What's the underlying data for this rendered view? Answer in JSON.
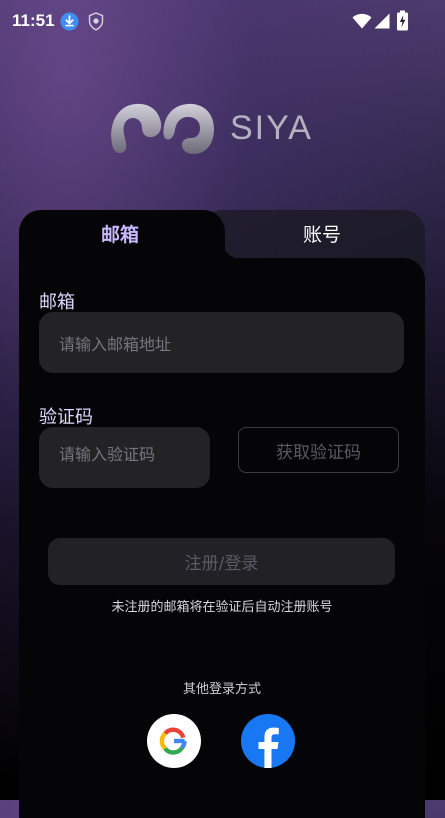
{
  "status_bar": {
    "time": "11:51",
    "icons": [
      "download-icon",
      "shield-icon",
      "wifi-icon",
      "signal-icon",
      "battery-charging-icon"
    ]
  },
  "logo": {
    "text": "SIYA",
    "icon": "siya-logo-icon"
  },
  "tabs": [
    {
      "label": "邮箱",
      "active": true
    },
    {
      "label": "账号",
      "active": false
    }
  ],
  "form": {
    "email_label": "邮箱",
    "email_placeholder": "请输入邮箱地址",
    "code_label": "验证码",
    "code_placeholder": "请输入验证码",
    "get_code_label": "获取验证码",
    "submit_label": "注册/登录",
    "hint": "未注册的邮箱将在验证后自动注册账号"
  },
  "other_login": {
    "label": "其他登录方式",
    "providers": [
      {
        "name": "google",
        "icon": "google-icon"
      },
      {
        "name": "facebook",
        "icon": "facebook-icon"
      }
    ]
  },
  "colors": {
    "accent_text": "#c7b8ff",
    "card_bg": "#050507",
    "input_bg": "#232326",
    "facebook_blue": "#1877f2"
  }
}
